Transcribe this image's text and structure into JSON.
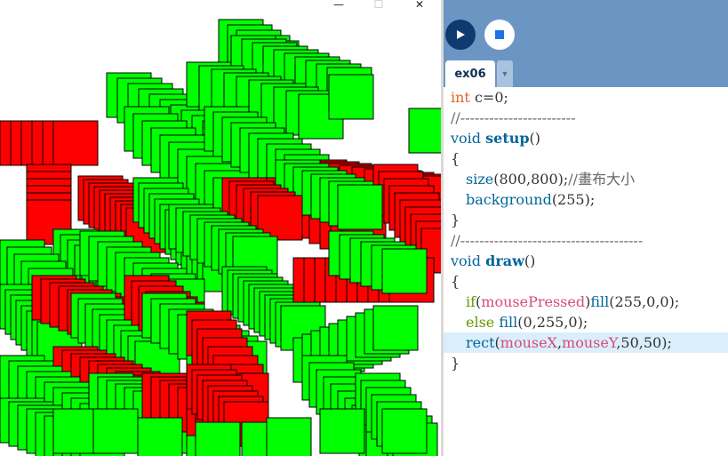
{
  "window_controls": {
    "minimize": "—",
    "maximize": "☐",
    "close": "✕"
  },
  "toolbar": {
    "run_icon": "play-icon",
    "stop_icon": "stop-icon"
  },
  "colors": {
    "toolbar_bg": "#6b96c4",
    "run_bg": "#0e3a70",
    "active_line": "#dbeefb",
    "red_fill": "#ff0000",
    "green_fill": "#00ff00"
  },
  "tabs": {
    "active": "ex06",
    "menu_arrow": "▼"
  },
  "code": {
    "l1": {
      "type": "int",
      "rest": " c=0;"
    },
    "l2": {
      "comment": "//------------------------"
    },
    "l3": {
      "kw": "void",
      "fn": "setup",
      "rest": "()"
    },
    "l4": {
      "text": "{"
    },
    "l5": {
      "fn": "size",
      "args": "(800,800);",
      "comment": "//畫布大小"
    },
    "l6": {
      "fn": "background",
      "args": "(255);"
    },
    "l7": {
      "text": "}"
    },
    "l8": {
      "comment": "//--------------------------------------"
    },
    "l9": {
      "kw": "void",
      "fn": "draw",
      "rest": "()"
    },
    "l10": {
      "text": "{"
    },
    "l11": {
      "ctl": "if",
      "p1": "(",
      "var": "mousePressed",
      "p2": ")",
      "fn": "fill",
      "args": "(255,0,0);"
    },
    "l12": {
      "ctl": "else",
      "fn": "fill",
      "args": "(0,255,0);"
    },
    "l13": {
      "fn": "rect",
      "p1": "(",
      "var1": "mouseX",
      "comma": ",",
      "var2": "mouseY",
      "args": ",50,50);"
    },
    "l14": {
      "text": "}"
    }
  }
}
